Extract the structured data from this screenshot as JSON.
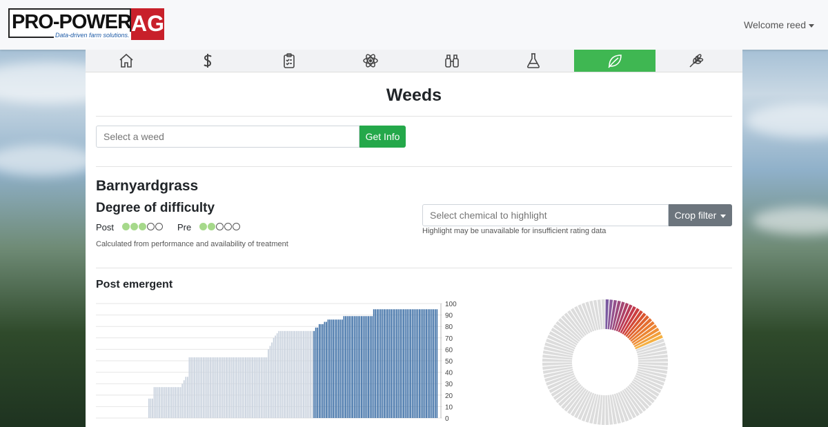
{
  "brand": {
    "name": "PRO-POWER",
    "suffix": "AG",
    "tagline": "Data-driven farm solutions."
  },
  "user_menu": {
    "label": "Welcome reed"
  },
  "tabs": [
    {
      "icon": "home-icon"
    },
    {
      "icon": "dollar-icon"
    },
    {
      "icon": "clipboard-icon"
    },
    {
      "icon": "atom-icon"
    },
    {
      "icon": "binoculars-icon"
    },
    {
      "icon": "flask-icon"
    },
    {
      "icon": "leaf-icon",
      "active": true
    },
    {
      "icon": "wheat-icon"
    }
  ],
  "page": {
    "title": "Weeds"
  },
  "search": {
    "placeholder": "Select a weed",
    "button": "Get Info"
  },
  "weed": {
    "name": "Barnyardgrass",
    "difficulty_title": "Degree of difficulty",
    "post": {
      "label": "Post",
      "rating": 3,
      "max": 5
    },
    "pre": {
      "label": "Pre",
      "rating": 2,
      "max": 5
    },
    "note": "Calculated from performance and availability of treatment"
  },
  "highlight": {
    "placeholder": "Select chemical to highlight",
    "crop_filter": "Crop filter",
    "note": "Highlight may be unavailable for insufficient rating data"
  },
  "section": {
    "post_emergent": "Post emergent"
  },
  "colors": {
    "accent_green": "#3fb752",
    "button_green": "#24a84a",
    "bar_light": "#c9d2de",
    "bar_dark": "#3d6fa6",
    "brand_red": "#c8202a"
  },
  "chart_data": [
    {
      "type": "bar",
      "ylim": [
        0,
        100
      ],
      "yticks": [
        0,
        10,
        20,
        30,
        40,
        50,
        60,
        70,
        80,
        90,
        100
      ],
      "values_light": [
        17,
        17,
        17,
        27,
        27,
        27,
        27,
        27,
        27,
        27,
        27,
        27,
        27,
        27,
        27,
        27,
        27,
        27,
        27,
        30,
        33,
        36,
        36,
        53,
        53,
        53,
        53,
        53,
        53,
        53,
        53,
        53,
        53,
        53,
        53,
        53,
        53,
        53,
        53,
        53,
        53,
        53,
        53,
        53,
        53,
        53,
        53,
        53,
        53,
        53,
        53,
        53,
        53,
        53,
        53,
        53,
        53,
        53,
        53,
        53,
        53,
        53,
        53,
        53,
        53,
        53,
        53,
        53,
        60,
        63,
        66,
        70,
        72,
        74,
        76,
        76,
        76,
        76,
        76,
        76,
        76,
        76,
        76,
        76,
        76,
        76,
        76,
        76,
        76,
        76,
        76,
        76,
        76,
        76
      ],
      "values_dark": [
        76,
        79,
        79,
        82,
        82,
        82,
        84,
        84,
        86,
        86,
        86,
        86,
        86,
        86,
        86,
        86,
        86,
        89,
        89,
        89,
        89,
        89,
        89,
        89,
        89,
        89,
        89,
        89,
        89,
        89,
        89,
        89,
        89,
        89,
        95,
        95,
        95,
        95,
        95,
        95,
        95,
        95,
        95,
        95,
        95,
        95,
        95,
        95,
        95,
        95,
        95,
        95,
        95,
        95,
        95,
        95,
        95,
        95,
        95,
        95,
        95,
        95,
        95,
        95,
        95,
        95,
        95,
        95,
        95,
        95,
        95
      ]
    },
    {
      "type": "pie",
      "style": "donut",
      "colored_segments": [
        "#7a5aa0",
        "#8b5a9a",
        "#94508c",
        "#9b4a7e",
        "#a34672",
        "#ad4066",
        "#b83c59",
        "#c33a4c",
        "#cb3e40",
        "#d24838",
        "#da5530",
        "#df6230",
        "#e46e30",
        "#e97a32",
        "#ec8534",
        "#ef9038",
        "#f2a03c",
        "#f5b042"
      ],
      "grey_segments": 78,
      "grey_color": "#dcdcdc"
    }
  ]
}
